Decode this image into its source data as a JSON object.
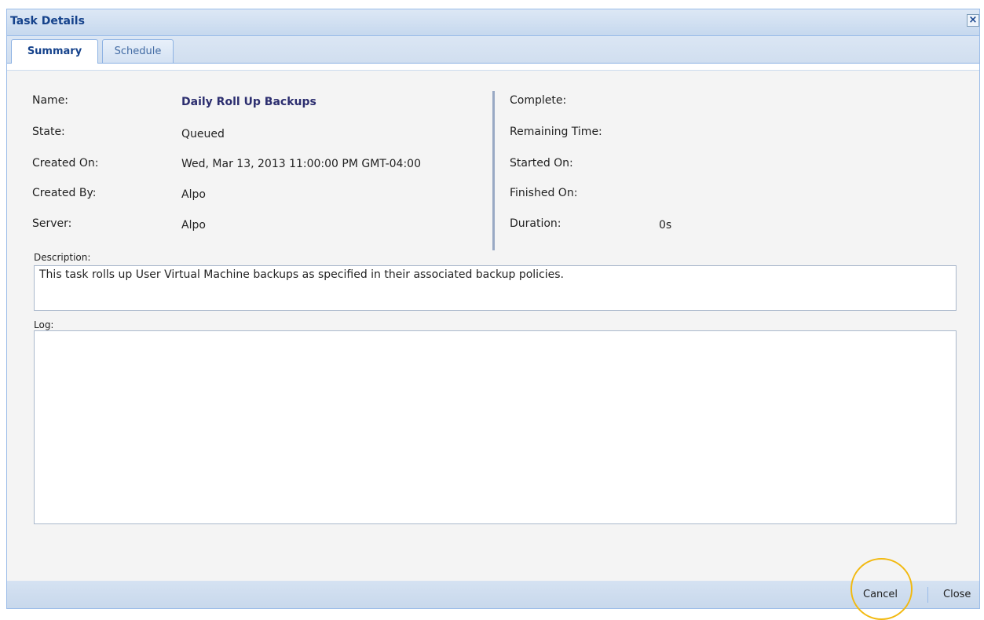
{
  "window": {
    "title": "Task Details"
  },
  "tabs": [
    {
      "label": "Summary",
      "active": true
    },
    {
      "label": "Schedule",
      "active": false
    }
  ],
  "summary": {
    "name_label": "Name:",
    "name_value": "Daily Roll Up Backups",
    "state_label": "State:",
    "state_value": "Queued",
    "created_on_label": "Created On:",
    "created_on_value": "Wed, Mar 13, 2013 11:00:00 PM GMT-04:00",
    "created_by_label": "Created By:",
    "created_by_value": "Alpo",
    "server_label": "Server:",
    "server_value": "Alpo",
    "complete_label": "Complete:",
    "complete_value": "",
    "remaining_label": "Remaining Time:",
    "remaining_value": "",
    "started_label": "Started On:",
    "started_value": "",
    "finished_label": "Finished On:",
    "finished_value": "",
    "duration_label": "Duration:",
    "duration_value": "0s",
    "description_label": "Description:",
    "description_value": "This task rolls up User Virtual Machine backups as specified in their associated backup policies.",
    "log_label": "Log:",
    "log_value": ""
  },
  "footer": {
    "cancel_label": "Cancel",
    "close_label": "Close"
  },
  "colors": {
    "title": "#15428b",
    "accent_border": "#99bbe8",
    "highlight_ring": "#f2b90f"
  }
}
